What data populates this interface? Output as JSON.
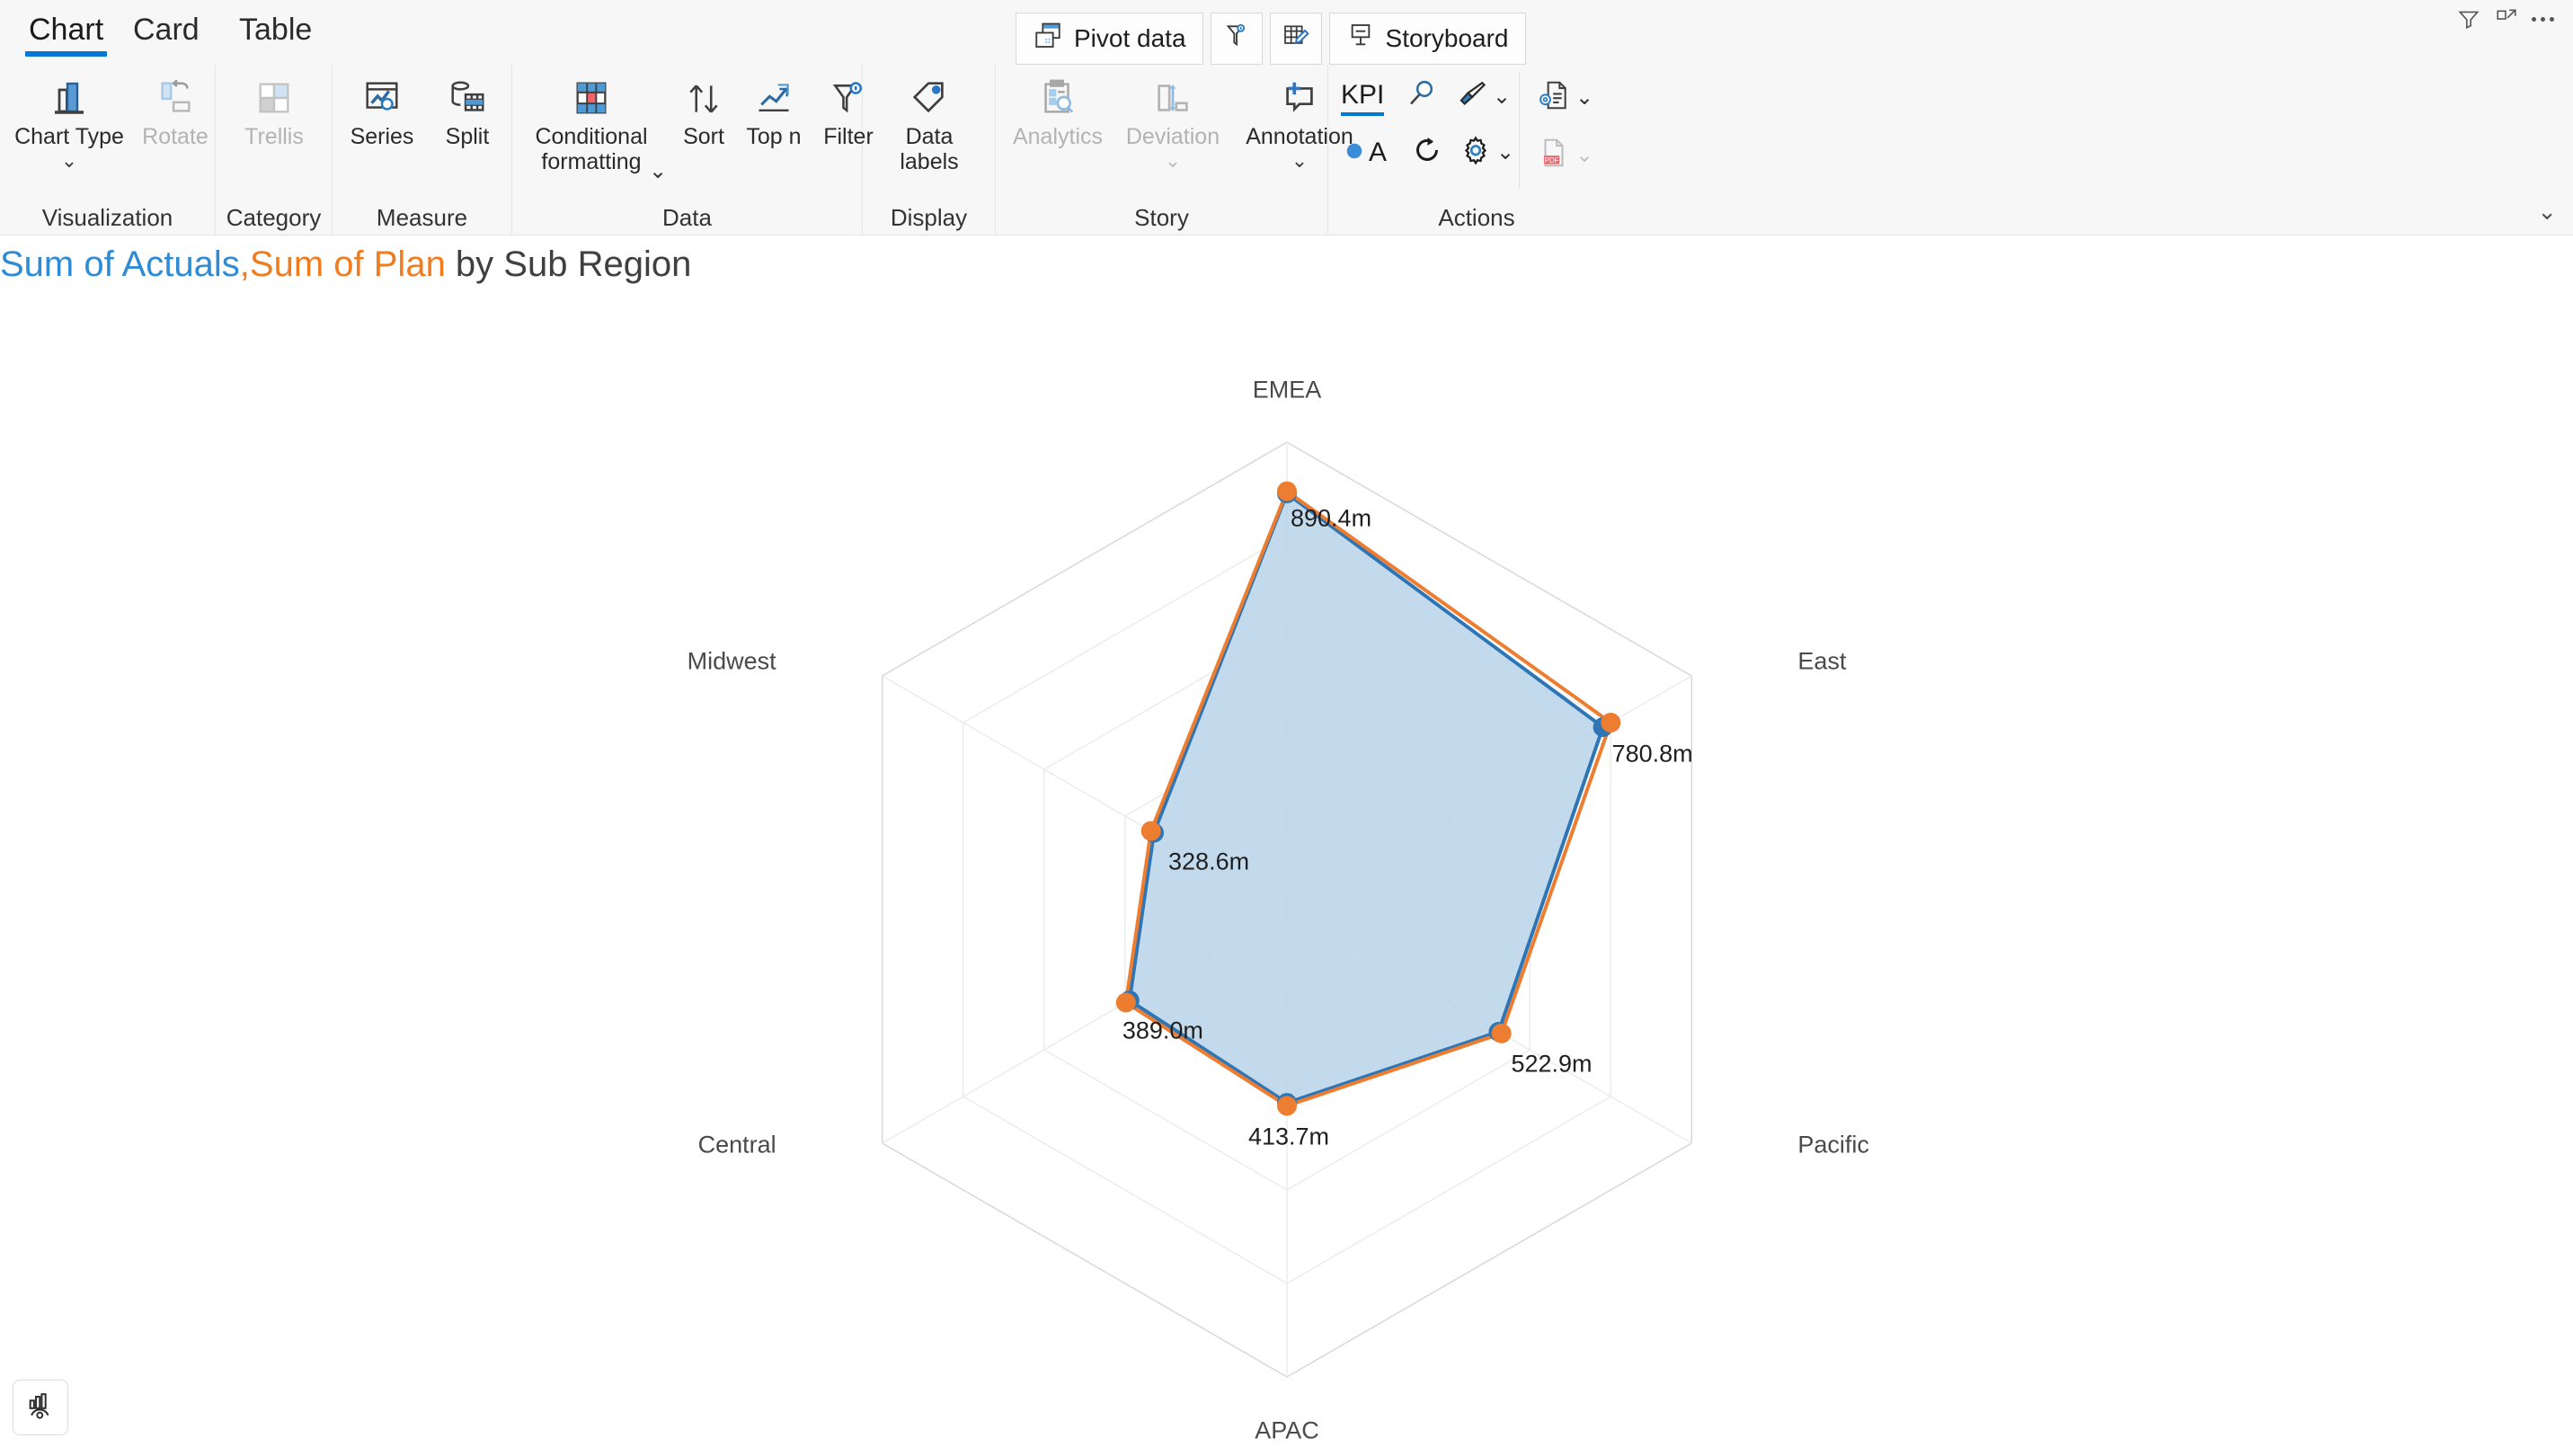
{
  "ribbon": {
    "tabs": [
      {
        "id": "chart",
        "label": "Chart",
        "active": true
      },
      {
        "id": "card",
        "label": "Card",
        "active": false
      },
      {
        "id": "table",
        "label": "Table",
        "active": false
      }
    ],
    "top_commands": [
      {
        "id": "pivot-data",
        "label": "Pivot data",
        "icon": "pivot-data-icon"
      },
      {
        "id": "filter",
        "label": "",
        "icon": "funnel-info-icon"
      },
      {
        "id": "edit-table",
        "label": "",
        "icon": "table-edit-icon"
      },
      {
        "id": "storyboard",
        "label": "Storyboard",
        "icon": "storyboard-icon"
      }
    ],
    "window_icons": [
      {
        "id": "filter",
        "name": "funnel-icon"
      },
      {
        "id": "expand",
        "name": "expand-icon"
      },
      {
        "id": "more",
        "name": "more-options-icon"
      }
    ],
    "collapse_caret": "⌄",
    "groups": [
      {
        "id": "visualization",
        "label": "Visualization",
        "items": [
          {
            "id": "chart-type",
            "label": "Chart Type",
            "icon": "bar-chart-icon",
            "caret": "⌄",
            "disabled": false
          },
          {
            "id": "rotate",
            "label": "Rotate",
            "icon": "rotate-icon",
            "caret": "",
            "disabled": true
          }
        ]
      },
      {
        "id": "category",
        "label": "Category",
        "items": [
          {
            "id": "trellis",
            "label": "Trellis",
            "icon": "trellis-icon",
            "caret": "",
            "disabled": true
          }
        ]
      },
      {
        "id": "measure",
        "label": "Measure",
        "items": [
          {
            "id": "series",
            "label": "Series",
            "icon": "series-icon",
            "caret": "",
            "disabled": false
          },
          {
            "id": "split",
            "label": "Split",
            "icon": "split-icon",
            "caret": "",
            "disabled": false
          }
        ]
      },
      {
        "id": "data",
        "label": "Data",
        "items": [
          {
            "id": "conditional-formatting",
            "label": "Conditional\nformatting",
            "icon": "conditional-formatting-icon",
            "caret": "⌄",
            "disabled": false
          },
          {
            "id": "sort",
            "label": "Sort",
            "icon": "sort-icon",
            "caret": "",
            "disabled": false
          },
          {
            "id": "top-n",
            "label": "Top n",
            "icon": "top-n-icon",
            "caret": "",
            "disabled": false
          },
          {
            "id": "filter",
            "label": "Filter",
            "icon": "filter-icon",
            "caret": "",
            "disabled": false
          }
        ]
      },
      {
        "id": "display",
        "label": "Display",
        "items": [
          {
            "id": "data-labels",
            "label": "Data\nlabels",
            "icon": "tag-icon",
            "caret": "",
            "disabled": false
          }
        ]
      },
      {
        "id": "story",
        "label": "Story",
        "items": [
          {
            "id": "analytics",
            "label": "Analytics",
            "icon": "analytics-icon",
            "caret": "",
            "disabled": true
          },
          {
            "id": "deviation",
            "label": "Deviation",
            "icon": "deviation-icon",
            "caret": "⌄",
            "disabled": true
          },
          {
            "id": "annotation",
            "label": "Annotation",
            "icon": "annotation-icon",
            "caret": "⌄",
            "disabled": false
          }
        ]
      },
      {
        "id": "actions",
        "label": "Actions",
        "small_items": [
          {
            "id": "kpi",
            "label": "KPI",
            "icon": "kpi-icon"
          },
          {
            "id": "search",
            "label": "",
            "icon": "magnifier-icon"
          },
          {
            "id": "brush",
            "label": "",
            "icon": "paintbrush-icon",
            "caret": "⌄"
          },
          {
            "id": "bubble-a",
            "label": "A",
            "icon": "bubble-a-icon"
          },
          {
            "id": "refresh",
            "label": "",
            "icon": "refresh-icon"
          },
          {
            "id": "settings",
            "label": "",
            "icon": "gear-icon",
            "caret": "⌄"
          },
          {
            "id": "doc-config",
            "label": "",
            "icon": "document-gear-icon",
            "caret": "⌄"
          },
          {
            "id": "export-pdf",
            "label": "",
            "icon": "pdf-icon",
            "caret": "⌄",
            "disabled": true
          }
        ]
      }
    ]
  },
  "chart_title": {
    "measure1": "Sum of Actuals",
    "comma": ",",
    "measure2": "Sum of Plan",
    "rest": " by Sub Region"
  },
  "fab": {
    "name": "chart-insight-icon"
  },
  "chart_data": {
    "type": "radar",
    "title": "Sum of Actuals,Sum of Plan by Sub Region",
    "xlabel": "Sub Region",
    "ylabel": "",
    "categories": [
      "EMEA",
      "East",
      "Pacific",
      "APAC",
      "Central",
      "Midwest"
    ],
    "data_labels": [
      "890.4m",
      "780.8m",
      "522.9m",
      "413.7m",
      "389.0m",
      "328.6m"
    ],
    "rings": 5,
    "grid": true,
    "legend_position": "none",
    "axis_max": 1000,
    "series": [
      {
        "name": "Sum of Actuals",
        "color": "#2e75b6",
        "fill": "#b8d4ea",
        "values": [
          890.4,
          780.8,
          522.9,
          413.7,
          389.0,
          328.6
        ]
      },
      {
        "name": "Sum of Plan",
        "color": "#ed7d31",
        "fill": "none",
        "values": [
          895.0,
          800.0,
          530.0,
          420.0,
          398.0,
          336.0
        ]
      }
    ]
  }
}
